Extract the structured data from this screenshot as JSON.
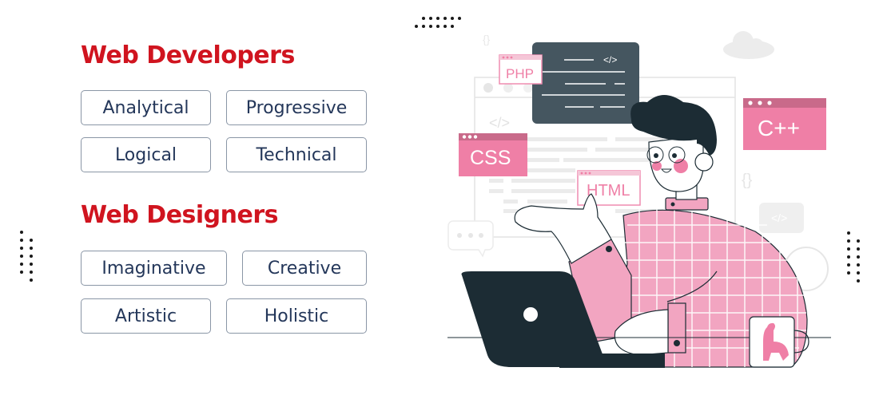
{
  "sections": [
    {
      "title": "Web Developers",
      "traits": [
        "Analytical",
        "Progressive",
        "Logical",
        "Technical"
      ]
    },
    {
      "title": "Web Designers",
      "traits": [
        "Imaginative",
        "Creative",
        "Artistic",
        "Holistic"
      ]
    }
  ],
  "illustration": {
    "badges": {
      "php": "PHP",
      "css": "CSS",
      "html": "HTML",
      "cpp": "C++"
    },
    "code_symbols": {
      "tag": "</>",
      "braces": "{}"
    }
  },
  "colors": {
    "heading": "#d0141f",
    "trait_text": "#24375a",
    "trait_border": "#8a96a6",
    "pink": "#ef7fa6",
    "pink_dark": "#c96a8a",
    "shirt": "#f2a5c1",
    "dark": "#1c2c34",
    "screen": "#455660"
  }
}
